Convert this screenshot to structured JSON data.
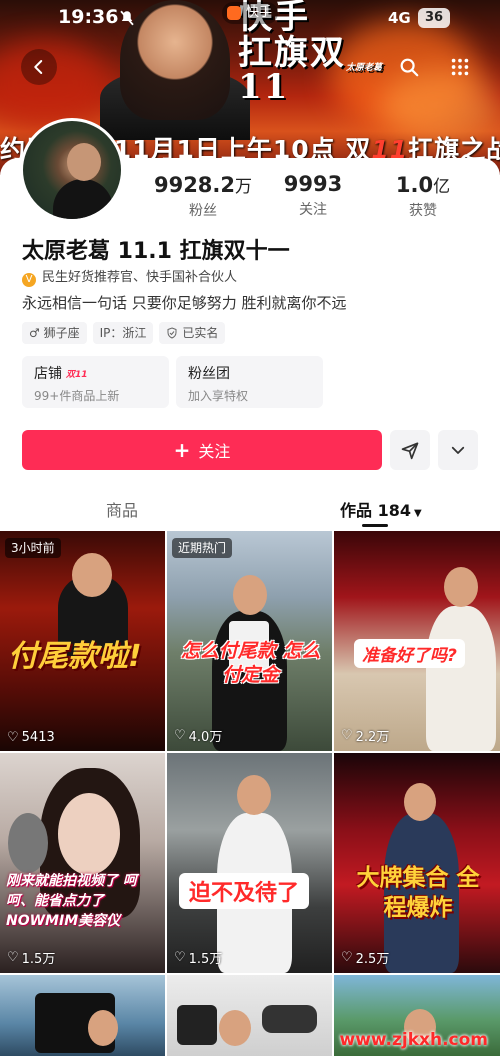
{
  "status_bar": {
    "time": "19:36",
    "app_badge": "快手",
    "network": "4G",
    "battery": "36"
  },
  "banner": {
    "slogan_line1": "快手",
    "slogan_line2": "扛旗双11",
    "signature": "太原老葛",
    "ticker_part1": "约原老葛 11月1日上午10点 双",
    "ticker_highlight": "11",
    "ticker_part2": "扛旗之战不见"
  },
  "profile": {
    "stats": [
      {
        "num": "9928.2",
        "unit": "万",
        "label": "粉丝"
      },
      {
        "num": "9993",
        "unit": "",
        "label": "关注"
      },
      {
        "num": "1.0",
        "unit": "亿",
        "label": "获赞"
      }
    ],
    "name": "太原老葛 11.1 扛旗双十一",
    "certification": "民生好货推荐官、快手国补合伙人",
    "bio": "永远相信一句话 只要你足够努力 胜利就离你不远",
    "tags": [
      "♂ 狮子座",
      "IP：浙江",
      "已实名"
    ]
  },
  "boxes": [
    {
      "title": "店铺",
      "badge": "双11",
      "desc": "99+件商品上新"
    },
    {
      "title": "粉丝团",
      "badge": "",
      "desc": "加入享特权"
    }
  ],
  "actions": {
    "follow_label": "关注"
  },
  "tabs": {
    "shop": "商品",
    "works": "作品 184"
  },
  "videos": [
    {
      "badge": "3小时前",
      "caption": "付尾款啦!",
      "likes": "5413"
    },
    {
      "badge": "近期热门",
      "caption": "怎么付尾款 怎么付定金",
      "likes": "4.0万"
    },
    {
      "badge": "",
      "caption": "准备好了吗?",
      "likes": "2.2万"
    },
    {
      "badge": "",
      "caption": "刚来就能拍视频了 呵呵、能省点力了 NOWMIM美容仪",
      "likes": "1.5万"
    },
    {
      "badge": "",
      "caption": "迫不及待了",
      "likes": "1.5万"
    },
    {
      "badge": "",
      "caption": "大牌集合 全程爆炸",
      "likes": "2.5万"
    }
  ],
  "watermark": "www.zjkxh.com",
  "colors": {
    "accent": "#fe2c55",
    "gold": "#f5a623"
  }
}
